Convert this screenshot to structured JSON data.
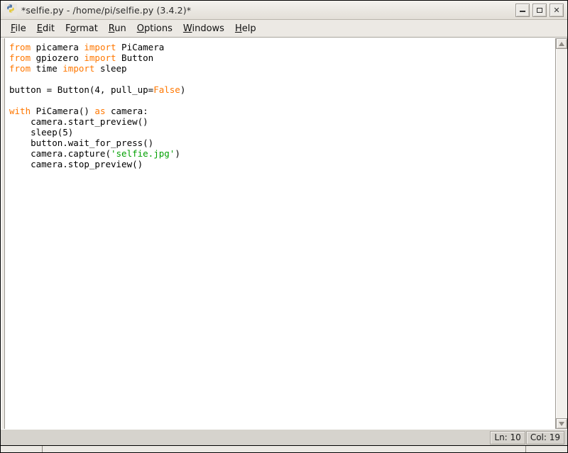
{
  "window": {
    "title": "*selfie.py - /home/pi/selfie.py (3.4.2)*",
    "icon": "python-logo-icon",
    "buttons": {
      "minimize": "minimize",
      "maximize": "maximize",
      "close": "close"
    }
  },
  "menubar": {
    "items": [
      {
        "label": "File",
        "accel_index": 0
      },
      {
        "label": "Edit",
        "accel_index": 0
      },
      {
        "label": "Format",
        "accel_index": 1
      },
      {
        "label": "Run",
        "accel_index": 0
      },
      {
        "label": "Options",
        "accel_index": 0
      },
      {
        "label": "Windows",
        "accel_index": 0
      },
      {
        "label": "Help",
        "accel_index": 0
      }
    ]
  },
  "editor": {
    "language": "python",
    "colors": {
      "keyword": "#ff7700",
      "string": "#00a000",
      "text": "#000000",
      "background": "#ffffff"
    },
    "lines": [
      [
        {
          "t": "from",
          "c": "kw"
        },
        {
          "t": " picamera ",
          "c": "plain"
        },
        {
          "t": "import",
          "c": "kw"
        },
        {
          "t": " PiCamera",
          "c": "plain"
        }
      ],
      [
        {
          "t": "from",
          "c": "kw"
        },
        {
          "t": " gpiozero ",
          "c": "plain"
        },
        {
          "t": "import",
          "c": "kw"
        },
        {
          "t": " Button",
          "c": "plain"
        }
      ],
      [
        {
          "t": "from",
          "c": "kw"
        },
        {
          "t": " time ",
          "c": "plain"
        },
        {
          "t": "import",
          "c": "kw"
        },
        {
          "t": " sleep",
          "c": "plain"
        }
      ],
      [],
      [
        {
          "t": "button = Button(4, pull_up=",
          "c": "plain"
        },
        {
          "t": "False",
          "c": "kw"
        },
        {
          "t": ")",
          "c": "plain"
        }
      ],
      [],
      [
        {
          "t": "with",
          "c": "kw"
        },
        {
          "t": " PiCamera() ",
          "c": "plain"
        },
        {
          "t": "as",
          "c": "kw"
        },
        {
          "t": " camera:",
          "c": "plain"
        }
      ],
      [
        {
          "t": "    camera.start_preview()",
          "c": "plain"
        }
      ],
      [
        {
          "t": "    sleep(5)",
          "c": "plain"
        }
      ],
      [
        {
          "t": "    button.wait_for_press()",
          "c": "plain"
        }
      ],
      [
        {
          "t": "    camera.capture(",
          "c": "plain"
        },
        {
          "t": "'selfie.jpg'",
          "c": "str"
        },
        {
          "t": ")",
          "c": "plain"
        }
      ],
      [
        {
          "t": "    camera.stop_preview()",
          "c": "plain"
        }
      ]
    ]
  },
  "scrollbar": {
    "up_arrow": "scroll-up-arrow-icon",
    "down_arrow": "scroll-down-arrow-icon"
  },
  "statusbar": {
    "line_label": "Ln: 10",
    "col_label": "Col: 19"
  }
}
